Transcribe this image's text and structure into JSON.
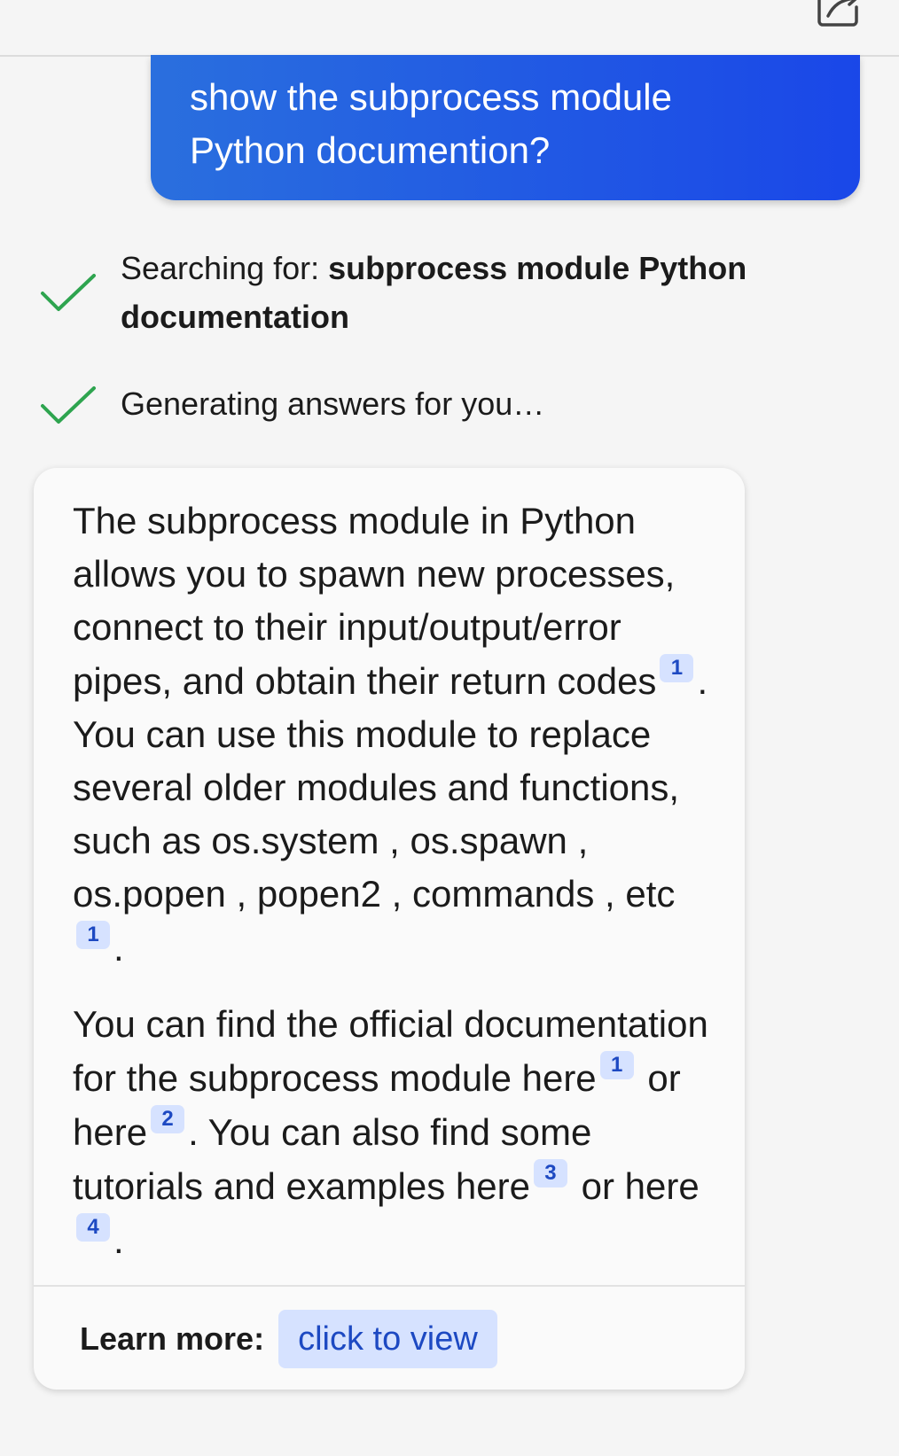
{
  "user_message": {
    "line1": "show the subprocess module",
    "line2": "Python documention?"
  },
  "status": {
    "searching_prefix": "Searching for: ",
    "searching_query_line1": "subprocess module Python",
    "searching_query_line2": "documentation",
    "generating": "Generating answers for you…"
  },
  "answer": {
    "p1": {
      "s1": "The subprocess module in Python allows you to spawn new processes, connect to their input/output/error pipes, and obtain their return codes",
      "c1": "1",
      "s2": ". You can use this module to replace several older modules and functions, such as os.system , os.spawn , os.popen , popen2 , commands , etc",
      "c2": "1",
      "s3": "."
    },
    "p2": {
      "s1": "You can find the official documentation for the subprocess module here",
      "c1": "1",
      "s2": " or here",
      "c2": "2",
      "s3": ". You can also find some tutorials and examples here",
      "c3": "3",
      "s4": " or here",
      "c4": "4",
      "s5": "."
    }
  },
  "learn_more": {
    "label": "Learn more:",
    "button": "click to view"
  },
  "colors": {
    "accent_blue": "#1a47e8",
    "check_green": "#2ea44f",
    "citation_bg": "#d6e2ff"
  },
  "icons": {
    "compose": "compose-icon",
    "check": "check-icon"
  }
}
